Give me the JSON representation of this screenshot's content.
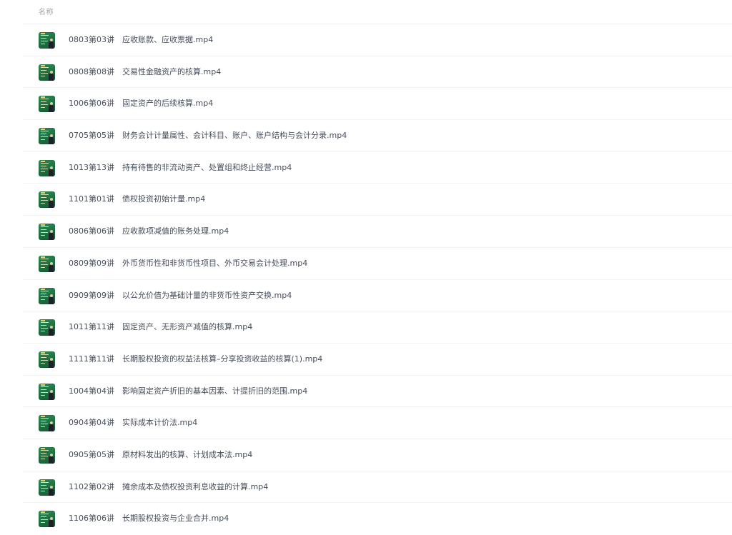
{
  "header": {
    "name_column_label": "名称"
  },
  "thumbnail_icon": "video-thumbnail-icon",
  "colors": {
    "thumbnail_green": "#1c6e3e",
    "text": "#454d5a",
    "header_text": "#a0a4ab",
    "divider": "#f1f2f4"
  },
  "files": [
    {
      "code": "0803第03讲",
      "title": "应收账款、应收票据.mp4"
    },
    {
      "code": "0808第08讲",
      "title": "交易性金融资产的核算.mp4"
    },
    {
      "code": "1006第06讲",
      "title": "固定资产的后续核算.mp4"
    },
    {
      "code": "0705第05讲",
      "title": "财务会计计量属性、会计科目、账户、账户结构与会计分录.mp4"
    },
    {
      "code": "1013第13讲",
      "title": "持有待售的非流动资产、处置组和终止经营.mp4"
    },
    {
      "code": "1101第01讲",
      "title": "债权投资初始计量.mp4"
    },
    {
      "code": "0806第06讲",
      "title": "应收款项减值的账务处理.mp4"
    },
    {
      "code": "0809第09讲",
      "title": "外币货币性和非货币性项目、外币交易会计处理.mp4"
    },
    {
      "code": "0909第09讲",
      "title": "以公允价值为基础计量的非货币性资产交换.mp4"
    },
    {
      "code": "1011第11讲",
      "title": "固定资产、无形资产减值的核算.mp4"
    },
    {
      "code": "1111第11讲",
      "title": "长期股权投资的权益法核算–分享投资收益的核算(1).mp4"
    },
    {
      "code": "1004第04讲",
      "title": "影响固定资产折旧的基本因素、计提折旧的范围.mp4"
    },
    {
      "code": "0904第04讲",
      "title": "实际成本计价法.mp4"
    },
    {
      "code": "0905第05讲",
      "title": "原材料发出的核算、计划成本法.mp4"
    },
    {
      "code": "1102第02讲",
      "title": "摊余成本及债权投资利息收益的计算.mp4"
    },
    {
      "code": "1106第06讲",
      "title": "长期股权投资与企业合并.mp4"
    }
  ]
}
